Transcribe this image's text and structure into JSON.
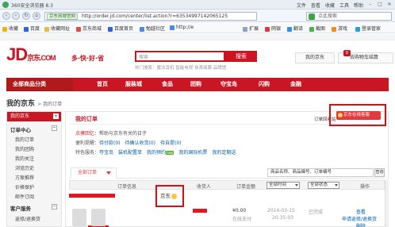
{
  "browser": {
    "title": "360安全浏览器 8.3",
    "menus": [
      "文件",
      "查看",
      "收藏",
      "工具",
      "帮助"
    ],
    "nav_buttons": [
      "‹",
      "›",
      "↻",
      "⌂"
    ],
    "site_badge": "京东商城官网",
    "url": "http://order.jd.com/center/list.action?r=63534997142065125",
    "search_placeholder": "点此搜索",
    "favorites": [
      "收藏",
      "百度",
      "收藏网址",
      "京东商城",
      "百度首页",
      "勉越社区",
      "http://e",
      "扩展",
      "网银",
      "翻译",
      "截图",
      "游戏",
      "登录管家"
    ]
  },
  "jd": {
    "logo": "JD",
    "logo_cn": "京东",
    "logo_com": ".COM",
    "slogan": "多·快·好·省",
    "search_placeholder": "搜索",
    "search_button": "搜索",
    "hot_words": "热门搜索：魔法耳机  智能电视  抹茶面膜  品牌馆",
    "my_jd": "我的京东",
    "cart_count": "0",
    "cart_label": "去购物车结算",
    "nav": {
      "all": "全部商品分类",
      "items": [
        "首页",
        "服装城",
        "食品",
        "团购",
        "夺宝岛",
        "闪购",
        "金融"
      ]
    }
  },
  "breadcrumb": {
    "title": "我的京东",
    "sub": "> 我的订单"
  },
  "sidebar": {
    "header": "我的京东",
    "sections": [
      {
        "title": "订单中心",
        "items": [
          "我的订单",
          "我的团购",
          "我的关注",
          "浏览历史",
          "方案推荐",
          "价格保护",
          "邮件订阅"
        ]
      },
      {
        "title": "客户服务",
        "items": [
          "返修/退换货"
        ]
      }
    ]
  },
  "main": {
    "title": "我的订单",
    "orders_back": "订单回收站",
    "online_service": "京东在线客服",
    "tip1_label": "点摸回忆：",
    "tip1_text": "帮助与京东有关的日子",
    "tip2_label": "便利提醒：",
    "tip2_items": [
      "待付款(0)",
      "待确认收货(0)",
      "待自提(0)"
    ],
    "tip3_label": "特色服务：",
    "tip3_items": [
      "夺宝岛",
      "装机配置单",
      "我的预约",
      "我的国际机票",
      "我的定期送"
    ],
    "new_badge": "new",
    "tab_all": "全部订单",
    "quick_search": "商品名称、商品编号、订单编号",
    "quick_search_btn": "查询",
    "table_headers": {
      "info": "订单信息",
      "receiver": "收货人",
      "amount": "订单金额",
      "time_select": "全部时间",
      "status_select": "全部状态",
      "actions": "操作"
    },
    "seller_badge": "京东",
    "order": {
      "amount": "¥0.00",
      "payment": "在线支付",
      "date": "2014-03-15",
      "time": "20:35:03",
      "status": "已完成",
      "action1": "查看",
      "action2": "申请返修/退换货",
      "action3": "删除"
    }
  },
  "colors": {
    "jd_red": "#c81623",
    "link_blue": "#005ea7",
    "highlight": "#d60f12"
  }
}
